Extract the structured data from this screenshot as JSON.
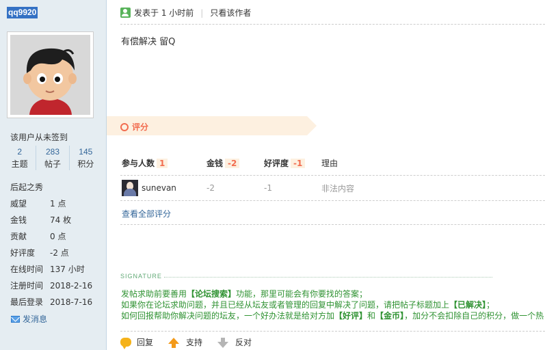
{
  "author": {
    "username": "qq9920",
    "signin_status": "该用户从未签到",
    "stats": [
      {
        "value": "2",
        "label": "主题"
      },
      {
        "value": "283",
        "label": "帖子"
      },
      {
        "value": "145",
        "label": "积分"
      }
    ],
    "group": "后起之秀",
    "profile": [
      {
        "key": "威望",
        "value": "1 点"
      },
      {
        "key": "金钱",
        "value": "74 枚"
      },
      {
        "key": "贡献",
        "value": "0 点"
      },
      {
        "key": "好评度",
        "value": "-2 点"
      },
      {
        "key": "在线时间",
        "value": "137 小时"
      },
      {
        "key": "注册时间",
        "value": "2018-2-16"
      },
      {
        "key": "最后登录",
        "value": "2018-7-16"
      }
    ],
    "send_message": "发消息"
  },
  "post": {
    "posted_at": "发表于 1 小时前",
    "author_only": "只看该作者",
    "content": "有偿解决 留Q"
  },
  "rating": {
    "title": "评分",
    "headers": {
      "participants": "参与人数",
      "participants_count": "1",
      "money": "金钱",
      "money_total": "-2",
      "reputation": "好评度",
      "reputation_total": "-1",
      "reason": "理由"
    },
    "rows": [
      {
        "user": "sunevan",
        "money": "-2",
        "reputation": "-1",
        "reason": "非法内容"
      }
    ],
    "view_all": "查看全部评分"
  },
  "signature": {
    "label": "SIGNATURE",
    "line1_a": "发帖求助前要善用",
    "line1_b": "【论坛搜索】",
    "line1_c": "功能，那里可能会有你要找的答案；",
    "line2_a": "如果你在论坛求助问题，并且已经从坛友或者管理的回复中解决了问题，请把帖子标题加上",
    "line2_b": "【已解决】",
    "line2_c": "；",
    "line3_a": "如何回报帮助你解决问题的坛友，一个好办法就是给对方加",
    "line3_b": "【好评】",
    "line3_c": "和",
    "line3_d": "【金币】",
    "line3_e": "，加分不会扣除自己的积分，做一个热"
  },
  "actions": {
    "reply": "回复",
    "support": "支持",
    "oppose": "反对"
  },
  "colors": {
    "sidebar_bg": "#e5edf2",
    "link": "#336699",
    "rating_accent": "#f26c4f",
    "signature_green": "#2f9232"
  }
}
